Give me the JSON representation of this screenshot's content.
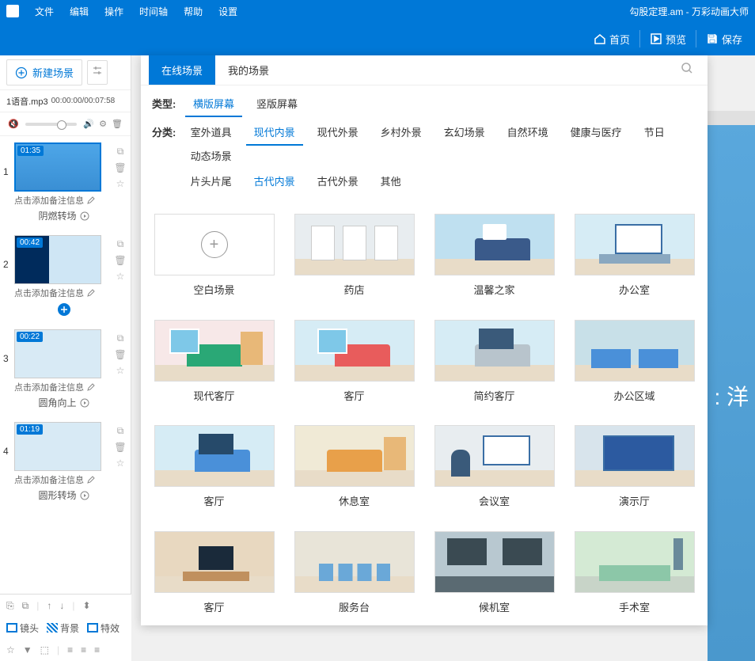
{
  "menubar": {
    "items": [
      "文件",
      "编辑",
      "操作",
      "时间轴",
      "帮助",
      "设置"
    ],
    "title": "勾股定理.am - 万彩动画大师"
  },
  "actionbar": {
    "home": "首页",
    "preview": "预览",
    "save": "保存"
  },
  "sidebar": {
    "new_scene": "新建场景",
    "audio_name": "1语音.mp3",
    "audio_time": "00:00:00/00:07:58",
    "note_placeholder": "点击添加备注信息",
    "scenes": [
      {
        "num": "1",
        "ts": "01:35",
        "trans": "阴燃转场"
      },
      {
        "num": "2",
        "ts": "00:42",
        "trans": ""
      },
      {
        "num": "3",
        "ts": "00:22",
        "trans": "圆角向上"
      },
      {
        "num": "4",
        "ts": "01:19",
        "trans": "圆形转场"
      }
    ]
  },
  "bottom": {
    "lens": "镜头",
    "background": "背景",
    "effects": "特效"
  },
  "popover": {
    "tabs": [
      "在线场景",
      "我的场景"
    ],
    "type_label": "类型:",
    "type_opts": [
      "横版屏幕",
      "竖版屏幕"
    ],
    "category_label": "分类:",
    "category_opts_row1": [
      "室外道具",
      "现代内景",
      "现代外景",
      "乡村外景",
      "玄幻场景",
      "自然环境",
      "健康与医疗",
      "节日",
      "动态场景"
    ],
    "category_opts_row2": [
      "片头片尾",
      "古代内景",
      "古代外景",
      "其他"
    ],
    "scenes": [
      {
        "label": "空白场景",
        "type": "empty"
      },
      {
        "label": "药店",
        "type": "pharmacy"
      },
      {
        "label": "温馨之家",
        "type": "home"
      },
      {
        "label": "办公室",
        "type": "office"
      },
      {
        "label": "现代客厅",
        "type": "living1"
      },
      {
        "label": "客厅",
        "type": "living2"
      },
      {
        "label": "简约客厅",
        "type": "living3"
      },
      {
        "label": "办公区域",
        "type": "office2"
      },
      {
        "label": "客厅",
        "type": "living4"
      },
      {
        "label": "休息室",
        "type": "lounge"
      },
      {
        "label": "会议室",
        "type": "meeting"
      },
      {
        "label": "演示厅",
        "type": "presentation"
      },
      {
        "label": "客厅",
        "type": "living5"
      },
      {
        "label": "服务台",
        "type": "service"
      },
      {
        "label": "候机室",
        "type": "wait"
      },
      {
        "label": "手术室",
        "type": "surgery"
      }
    ]
  },
  "canvas": {
    "partial_text": ": 洋"
  }
}
